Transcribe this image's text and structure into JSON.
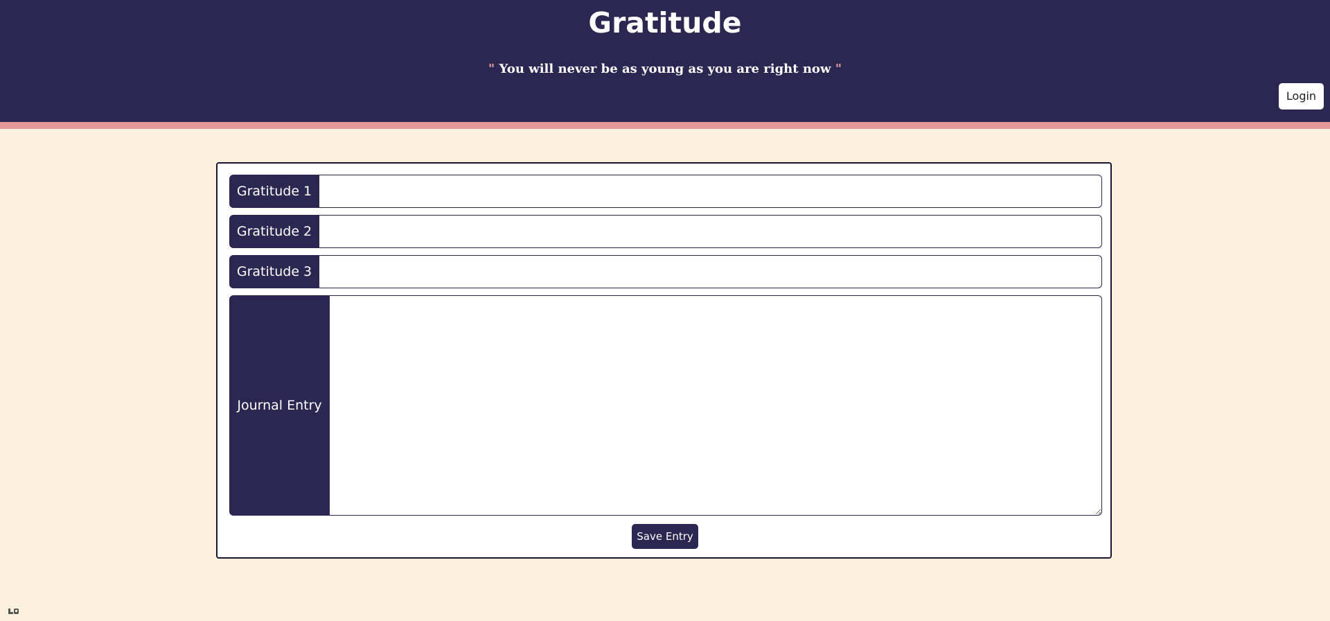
{
  "header": {
    "title": "Gratitude",
    "quote_open": "\"",
    "quote_text": " You will never be as young as you are right now ",
    "quote_close": "\"",
    "login_label": "Login"
  },
  "form": {
    "fields": [
      {
        "label": "Gratitude 1",
        "value": ""
      },
      {
        "label": "Gratitude 2",
        "value": ""
      },
      {
        "label": "Gratitude 3",
        "value": ""
      }
    ],
    "journal": {
      "label": "Journal Entry",
      "value": ""
    },
    "save_label": "Save Entry"
  },
  "colors": {
    "header_bg": "#2b2751",
    "accent_stripe": "#e49a98",
    "page_bg": "#fbf1dc",
    "card_bg": "#ffffff"
  }
}
